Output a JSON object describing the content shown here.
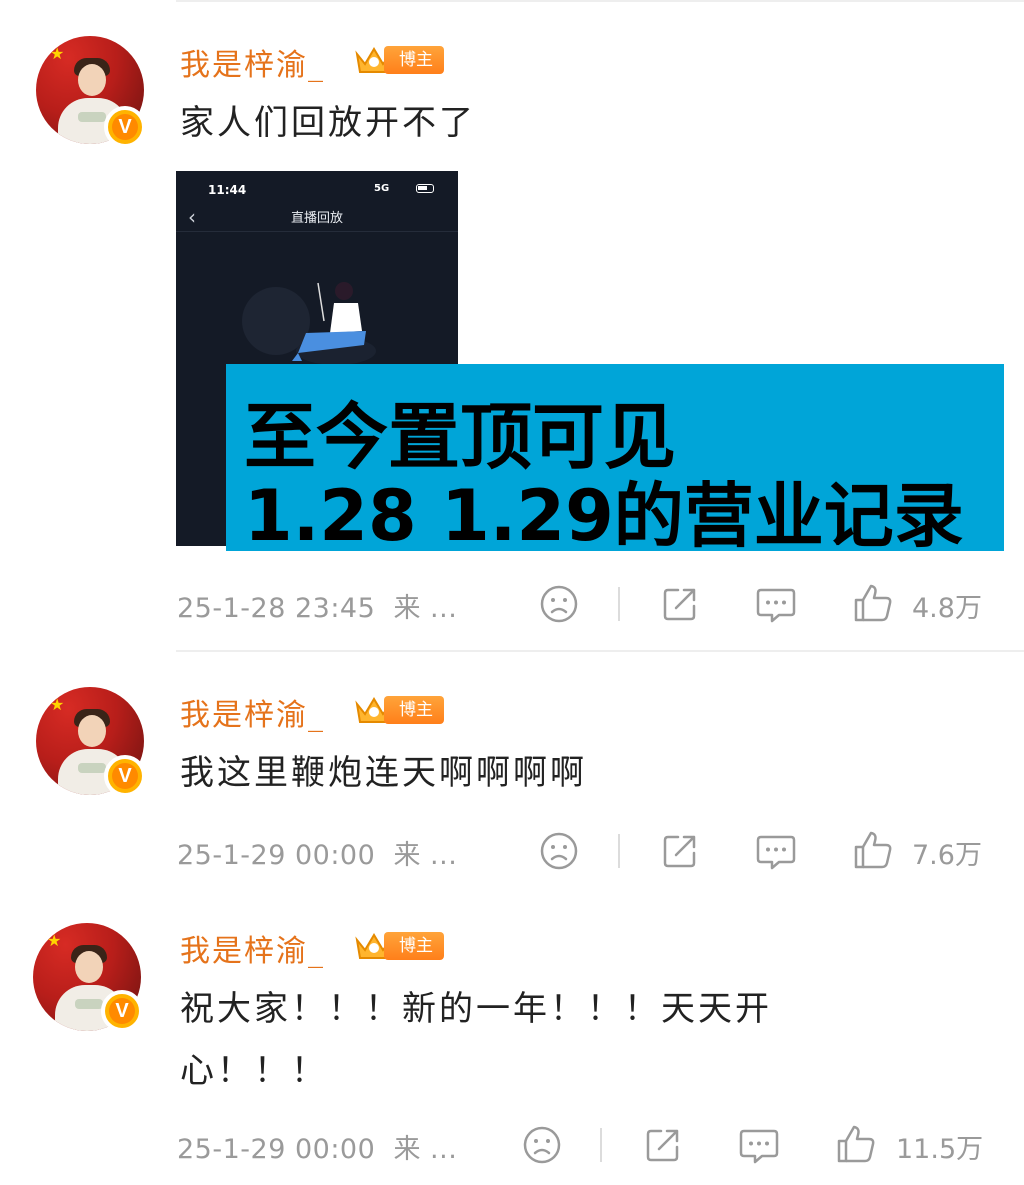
{
  "posts": [
    {
      "username": "我是梓渝_",
      "badge": "博主",
      "verified_mark": "V",
      "content_lines": [
        "家人们回放开不了"
      ],
      "screenshot": {
        "status_time": "11:44",
        "status_right": "5G",
        "title": "直播回放",
        "back": "‹"
      },
      "overlay_lines": [
        "至今置顶可见",
        "1.28 1.29的营业记录"
      ],
      "timestamp": "25-1-28 23:45",
      "source": "来 ...",
      "likes": "4.8万"
    },
    {
      "username": "我是梓渝_",
      "badge": "博主",
      "verified_mark": "V",
      "content_lines": [
        "我这里鞭炮连天啊啊啊啊"
      ],
      "timestamp": "25-1-29 00:00",
      "source": "来 ...",
      "likes": "7.6万"
    },
    {
      "username": "我是梓渝_",
      "badge": "博主",
      "verified_mark": "V",
      "content_lines": [
        "祝大家！！！新的一年！！！天天开",
        "心！！！"
      ],
      "timestamp": "25-1-29 00:00",
      "source": "来 ...",
      "likes": "11.5万"
    }
  ],
  "icons": [
    "sad-face-icon",
    "share-icon",
    "comment-icon",
    "thumbs-up-icon",
    "crown-icon",
    "verified-icon"
  ],
  "colors": {
    "username": "#e5731b",
    "badge": "#ff8a1f",
    "overlay": "#00a5d8",
    "meta": "#9a9a9a"
  }
}
